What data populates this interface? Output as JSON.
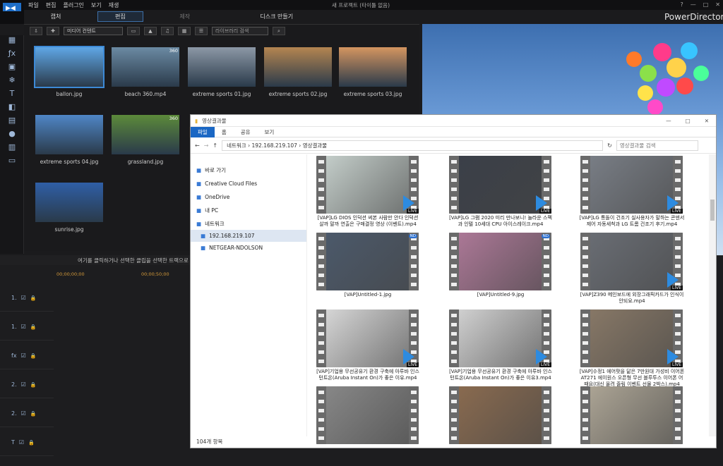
{
  "app": {
    "menu": [
      "파일",
      "편집",
      "플러그인",
      "보기",
      "재생"
    ],
    "window_title": "새 프로젝트 (타이틀 없음)",
    "brand": "PowerDirector",
    "modes": [
      "캡처",
      "편집",
      "제작",
      "디스크 만들기"
    ]
  },
  "library": {
    "dropdown": "미디어 컨텐트",
    "search_placeholder": "라이브러리 검색",
    "items": [
      {
        "label": "ballon.jpg",
        "color": "#5fa7e6"
      },
      {
        "label": "beach 360.mp4",
        "color": "#6b8aa3",
        "badge": "360"
      },
      {
        "label": "extreme sports 01.jpg",
        "color": "#8c98a6"
      },
      {
        "label": "extreme sports 02.jpg",
        "color": "#b48550"
      },
      {
        "label": "extreme sports 03.jpg",
        "color": "#d49560"
      },
      {
        "label": "extreme sports 04.jpg",
        "color": "#4f86c6"
      },
      {
        "label": "grassland.jpg",
        "color": "#5c8a3a",
        "badge": "360"
      },
      {
        "label": "sunrise.jpg",
        "color": "#2f5fa6"
      }
    ]
  },
  "timeline": {
    "hint": "여기를 클릭하거나 선택한 클립을 선택한 트랙으로",
    "time1": "00;00;00;00",
    "time2": "00;00;50;00",
    "tracks": [
      "1.",
      "1.",
      "fx",
      "2.",
      "2.",
      "T"
    ]
  },
  "explorer": {
    "title": "영상결과물",
    "ribbon": [
      "파일",
      "홈",
      "공유",
      "보기"
    ],
    "address": [
      "네트워크",
      "192.168.219.107",
      "영상결과물"
    ],
    "search_placeholder": "영상결과물 검색",
    "nav": [
      {
        "label": "바로 가기",
        "icon": "star-icon",
        "indent": 8
      },
      {
        "label": "Creative Cloud Files",
        "icon": "cc-icon",
        "indent": 8
      },
      {
        "label": "OneDrive",
        "icon": "cloud-icon",
        "indent": 8
      },
      {
        "label": "내 PC",
        "icon": "pc-icon",
        "indent": 8
      },
      {
        "label": "네트워크",
        "icon": "network-icon",
        "indent": 8
      },
      {
        "label": "192.168.219.107",
        "icon": "computer-icon",
        "indent": 14,
        "selected": true
      },
      {
        "label": "NETGEAR-NDOLSON",
        "icon": "computer-icon",
        "indent": 14
      }
    ],
    "files": [
      {
        "label": "[VAP]LG DIOS 인덕션 써본 사람만 안다 인덕션 살까 말까 연출은 구매결정 영상 (이벤트).mp4",
        "live": true,
        "color": "#c9d3cf"
      },
      {
        "label": "[VAP]LG 그램 2020 미리 만나보니! 놀라운 스펙과 인텔 10세대 CPU 아이스레이크.mp4",
        "live": true,
        "color": "#3a3f48"
      },
      {
        "label": "[VAP]LG 통돌이 건조기 실사용자가 말하는 콘덴서 제어 자동세척과 LG 트롬 건조기 후기.mp4",
        "live": true,
        "color": "#7b8088"
      },
      {
        "label": "[VAP]Untitled-1.jpg",
        "live": false,
        "color": "#4c5a6c",
        "nd": true
      },
      {
        "label": "[VAP]Untitled-9.jpg",
        "live": false,
        "color": "#b07a9a",
        "nd": true
      },
      {
        "label": "[VAP]Z390 메인보드에 외장그래픽카드가 인식이 안되요.mp4",
        "live": true,
        "color": "#6b6f76"
      },
      {
        "label": "[VAP]기업용 무선공유기 환경 구축에 아루바 인스턴트온(Aruba Instant On)가 좋은 이유.mp4",
        "live": true,
        "color": "#dcdcdc"
      },
      {
        "label": "[VAP]기업용 무선공유기 환경 구축에 아루바 인스턴트온(Aruba Instant On)가 좋은 이유3.mp4",
        "live": true,
        "color": "#d6d6d6"
      },
      {
        "label": "[VAP]수정1 에어팟을 닮은 7만원대 가성비 이어폰 AT271 에이원스 오픈형 무선 블루투스 이어폰 어때요(대신 올려 줄림 이벤트 선물 2박스).mp4",
        "live": true,
        "color": "#8a7a68"
      },
      {
        "label": "",
        "live": false,
        "color": "#8a8a8a"
      },
      {
        "label": "",
        "live": false,
        "color": "#8c6c50"
      },
      {
        "label": "",
        "live": false,
        "color": "#b0a898"
      }
    ],
    "status": "104개 항목"
  }
}
